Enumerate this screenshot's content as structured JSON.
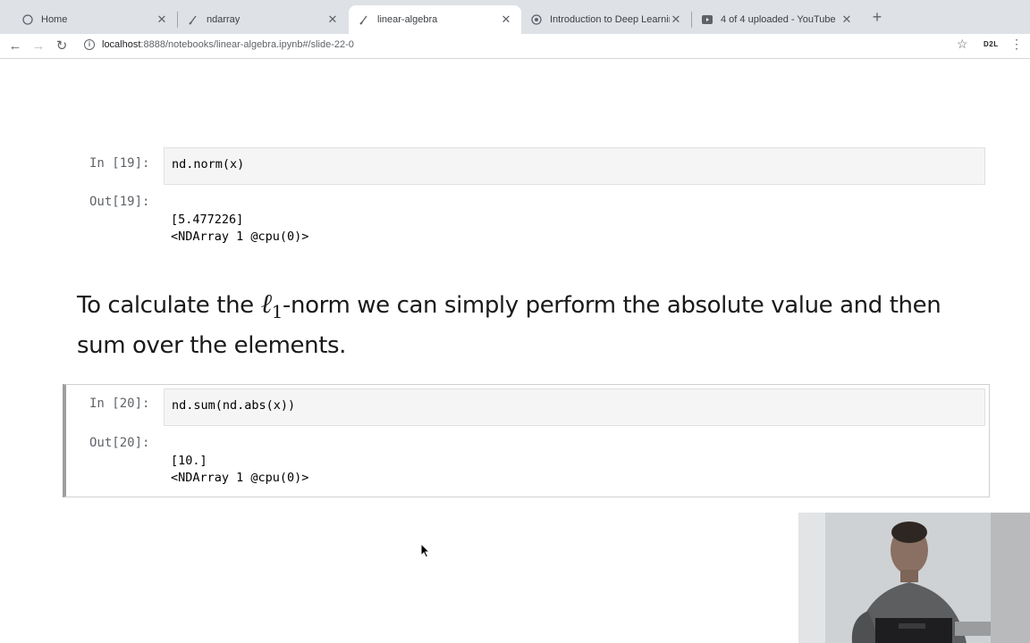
{
  "tabs": [
    {
      "label": "Home",
      "icon": "jupyter-icon"
    },
    {
      "label": "ndarray",
      "icon": "notebook-icon"
    },
    {
      "label": "linear-algebra",
      "icon": "notebook-icon",
      "active": true
    },
    {
      "label": "Introduction to Deep Learning",
      "icon": "chrome-icon"
    },
    {
      "label": "4 of 4 uploaded - YouTube",
      "icon": "youtube-icon"
    }
  ],
  "address": {
    "host": "localhost",
    "path": ":8888/notebooks/linear-algebra.ipynb#/slide-22-0"
  },
  "extension_label": "D2L",
  "cells": {
    "in19": {
      "prompt": "In [19]:",
      "code": "nd.norm(x)"
    },
    "out19": {
      "prompt": "Out[19]:",
      "line1": "[5.477226]",
      "line2": "<NDArray 1 @cpu(0)>"
    },
    "markdown": {
      "before": "To calculate the ",
      "ell": "ℓ",
      "sub": "1",
      "after": "-norm we can simply perform the absolute value and then sum over the elements."
    },
    "in20": {
      "prompt": "In [20]:",
      "code": "nd.sum(nd.abs(x))"
    },
    "out20": {
      "prompt": "Out[20]:",
      "line1": "[10.]",
      "line2": "<NDArray 1 @cpu(0)>"
    }
  },
  "colors": {
    "in_prompt": "#303f9f",
    "out_prompt": "#d84315",
    "tabbar": "#dee1e6"
  }
}
